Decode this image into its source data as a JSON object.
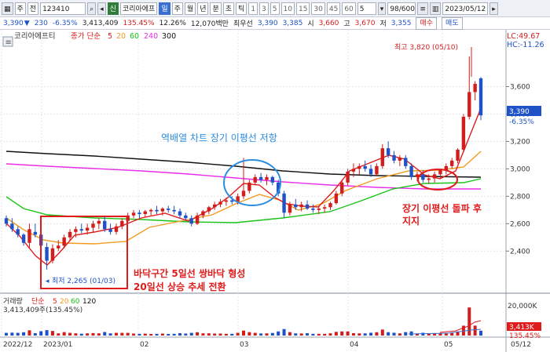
{
  "toolbar": {
    "market": "주",
    "market2": "전",
    "code": "123410",
    "new_badge": "신",
    "name": "코리아에프",
    "period_selected": "일",
    "periods": [
      "주",
      "월",
      "년",
      "분",
      "초",
      "틱"
    ],
    "intervals": [
      "1",
      "3",
      "5",
      "10",
      "15",
      "30",
      "45",
      "60"
    ],
    "interval_value": "5",
    "count": "98/600",
    "date": "2023/05/12"
  },
  "quote": {
    "price": "3,390",
    "change": "230",
    "change_pct": "-6.35%",
    "volume": "3,413,409",
    "vol_ratio": "135.45%",
    "turnover_rate": "12.26%",
    "amount": "12,070백만",
    "best_ask_label": "최우선",
    "best_ask": "3,390",
    "best_bid": "3,385",
    "open_label": "시",
    "open": "3,660",
    "high_label": "고",
    "high": "3,670",
    "low_label": "저",
    "low": "3,355",
    "buy_label": "매수",
    "sell_label": "매도"
  },
  "price_panel": {
    "name_label": "코리아에프티",
    "ma_prefix": "종가 단순",
    "ma_periods": [
      "5",
      "20",
      "60",
      "240",
      "300"
    ],
    "lc": "LC:49.67",
    "hc": "HC:-11.26",
    "current_label": "3,390",
    "current_pct": "-6.35%"
  },
  "volume_panel": {
    "label": "거래량",
    "ma_prefix": "단순",
    "ma_periods": [
      "5",
      "20",
      "60",
      "120"
    ],
    "value_text": "3,413,409주(135.45%)",
    "axis_label": "20,000K",
    "current_label": "3,413K",
    "current_pct": "135.45%"
  },
  "annotations": {
    "high_label": "최고 3,820 (05/10)",
    "low_label": "최저 2,265 (01/03)",
    "text_blue": "역배열 차트 장기 이평선 저항",
    "text_red_1": "장기 이평선 돌파 후",
    "text_red_2": "지지",
    "text_box_1": "바닥구간 5일선 쌍바닥 형성",
    "text_box_2": "20일선 상승 추세 전환"
  },
  "colors": {
    "up": "#d21d1d",
    "down": "#1f52c6",
    "ma5": "#e01b1b",
    "ma20": "#f39a1f",
    "ma60": "#18c418",
    "ma240": "#e82ee8",
    "ma300": "#111111"
  },
  "chart_data": {
    "type": "candlestick",
    "y_ticks": [
      "3,600",
      "3,400",
      "3,200",
      "3,000",
      "2,800",
      "2,600",
      "2,400"
    ],
    "x_labels": [
      "2022/12",
      "2023/01",
      "02",
      "03",
      "04",
      "05",
      "05/12"
    ],
    "ylim": [
      2150,
      3900
    ],
    "candles": [
      [
        2640,
        2660,
        2580,
        2600
      ],
      [
        2600,
        2640,
        2540,
        2560
      ],
      [
        2560,
        2580,
        2500,
        2520
      ],
      [
        2520,
        2530,
        2440,
        2460
      ],
      [
        2460,
        2600,
        2420,
        2560
      ],
      [
        2540,
        2600,
        2500,
        2520
      ],
      [
        2520,
        2560,
        2420,
        2440
      ],
      [
        2430,
        2460,
        2265,
        2330
      ],
      [
        2330,
        2450,
        2310,
        2420
      ],
      [
        2420,
        2480,
        2400,
        2440
      ],
      [
        2440,
        2520,
        2420,
        2500
      ],
      [
        2500,
        2560,
        2480,
        2540
      ],
      [
        2540,
        2580,
        2500,
        2560
      ],
      [
        2560,
        2600,
        2530,
        2550
      ],
      [
        2550,
        2600,
        2520,
        2570
      ],
      [
        2570,
        2620,
        2540,
        2600
      ],
      [
        2600,
        2640,
        2560,
        2620
      ],
      [
        2620,
        2650,
        2540,
        2560
      ],
      [
        2560,
        2600,
        2520,
        2540
      ],
      [
        2540,
        2600,
        2520,
        2580
      ],
      [
        2580,
        2640,
        2560,
        2620
      ],
      [
        2620,
        2680,
        2600,
        2660
      ],
      [
        2660,
        2700,
        2640,
        2680
      ],
      [
        2680,
        2700,
        2640,
        2670
      ],
      [
        2670,
        2700,
        2650,
        2690
      ],
      [
        2690,
        2710,
        2660,
        2700
      ],
      [
        2700,
        2730,
        2670,
        2690
      ],
      [
        2690,
        2720,
        2660,
        2710
      ],
      [
        2710,
        2730,
        2680,
        2700
      ],
      [
        2700,
        2730,
        2670,
        2690
      ],
      [
        2690,
        2710,
        2640,
        2660
      ],
      [
        2660,
        2680,
        2620,
        2640
      ],
      [
        2640,
        2660,
        2580,
        2600
      ],
      [
        2600,
        2680,
        2590,
        2660
      ],
      [
        2660,
        2700,
        2640,
        2690
      ],
      [
        2690,
        2730,
        2670,
        2720
      ],
      [
        2720,
        2760,
        2700,
        2740
      ],
      [
        2740,
        2780,
        2720,
        2760
      ],
      [
        2760,
        2790,
        2730,
        2770
      ],
      [
        2770,
        2800,
        2740,
        2760
      ],
      [
        2760,
        2820,
        2740,
        2800
      ],
      [
        2800,
        3080,
        2780,
        2840
      ],
      [
        2840,
        2920,
        2820,
        2900
      ],
      [
        2900,
        2960,
        2880,
        2940
      ],
      [
        2940,
        2970,
        2900,
        2920
      ],
      [
        2920,
        2960,
        2880,
        2940
      ],
      [
        2940,
        2950,
        2880,
        2900
      ],
      [
        2900,
        2920,
        2800,
        2820
      ],
      [
        2820,
        2840,
        2640,
        2680
      ],
      [
        2680,
        2760,
        2660,
        2740
      ],
      [
        2740,
        2780,
        2700,
        2720
      ],
      [
        2720,
        2760,
        2690,
        2740
      ],
      [
        2740,
        2770,
        2700,
        2710
      ],
      [
        2710,
        2740,
        2680,
        2700
      ],
      [
        2700,
        2730,
        2670,
        2710
      ],
      [
        2710,
        2740,
        2680,
        2720
      ],
      [
        2720,
        2760,
        2700,
        2750
      ],
      [
        2750,
        2840,
        2740,
        2820
      ],
      [
        2820,
        2920,
        2800,
        2900
      ],
      [
        2900,
        3000,
        2880,
        2980
      ],
      [
        2980,
        3040,
        2940,
        3000
      ],
      [
        3000,
        3040,
        2960,
        3020
      ],
      [
        3020,
        3060,
        2980,
        3000
      ],
      [
        3000,
        3030,
        2940,
        2960
      ],
      [
        2960,
        3040,
        2950,
        3020
      ],
      [
        3020,
        3180,
        3000,
        3150
      ],
      [
        3150,
        3200,
        3080,
        3100
      ],
      [
        3100,
        3130,
        3040,
        3060
      ],
      [
        3060,
        3100,
        3020,
        3080
      ],
      [
        3080,
        3100,
        3000,
        3020
      ],
      [
        3020,
        3040,
        2920,
        2940
      ],
      [
        2940,
        2980,
        2910,
        2960
      ],
      [
        2960,
        2990,
        2900,
        2920
      ],
      [
        2920,
        2960,
        2890,
        2930
      ],
      [
        2930,
        2980,
        2900,
        2960
      ],
      [
        2960,
        3000,
        2930,
        2990
      ],
      [
        2990,
        3040,
        2960,
        3020
      ],
      [
        3020,
        3080,
        3000,
        3060
      ],
      [
        3060,
        3150,
        3040,
        3140
      ],
      [
        3140,
        3400,
        3120,
        3380
      ],
      [
        3380,
        3820,
        3360,
        3560
      ],
      [
        3560,
        3640,
        3500,
        3620
      ],
      [
        3660,
        3670,
        3355,
        3390
      ]
    ],
    "volume_max": 21000
  }
}
